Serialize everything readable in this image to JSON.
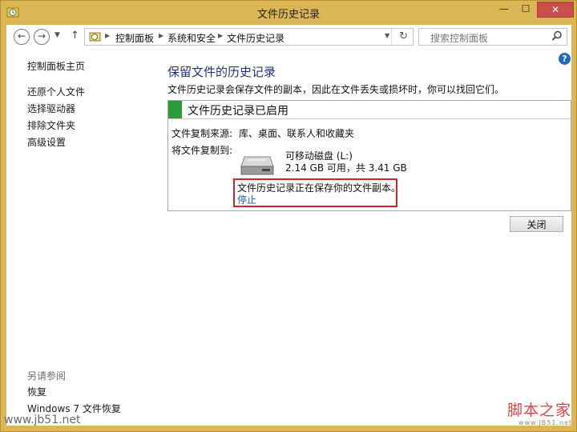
{
  "window": {
    "title": "文件历史记录",
    "min_glyph": "—",
    "max_glyph": "☐",
    "close_glyph": "✕"
  },
  "toolbar": {
    "breadcrumbs": [
      "控制面板",
      "系统和安全",
      "文件历史记录"
    ],
    "search_placeholder": "搜索控制面板"
  },
  "sidebar": {
    "items": [
      {
        "label": "控制面板主页"
      },
      {
        "label": "还原个人文件"
      },
      {
        "label": "选择驱动器"
      },
      {
        "label": "排除文件夹"
      },
      {
        "label": "高级设置"
      }
    ],
    "see_also": {
      "heading": "另请参阅",
      "items": [
        {
          "label": "恢复"
        },
        {
          "label": "Windows 7 文件恢复"
        }
      ]
    }
  },
  "main": {
    "heading": "保留文件的历史记录",
    "description": "文件历史记录会保存文件的副本，因此在文件丢失或损坏时，你可以找回它们。",
    "status_title": "文件历史记录已启用",
    "status_color": "#2a9d3a",
    "copy_from_label": "文件复制来源:",
    "copy_from_value": "库、桌面、联系人和收藏夹",
    "copy_to_label": "将文件复制到:",
    "drive_name": "可移动磁盘 (L:)",
    "drive_space": "2.14 GB 可用，共 3.41 GB",
    "saving_text": "文件历史记录正在保存你的文件副本。",
    "stop_link": "停止",
    "close_button": "关闭"
  },
  "watermark": {
    "left": "www.jb51.net",
    "brand": "脚本之家",
    "site": "www.JB51.net"
  }
}
